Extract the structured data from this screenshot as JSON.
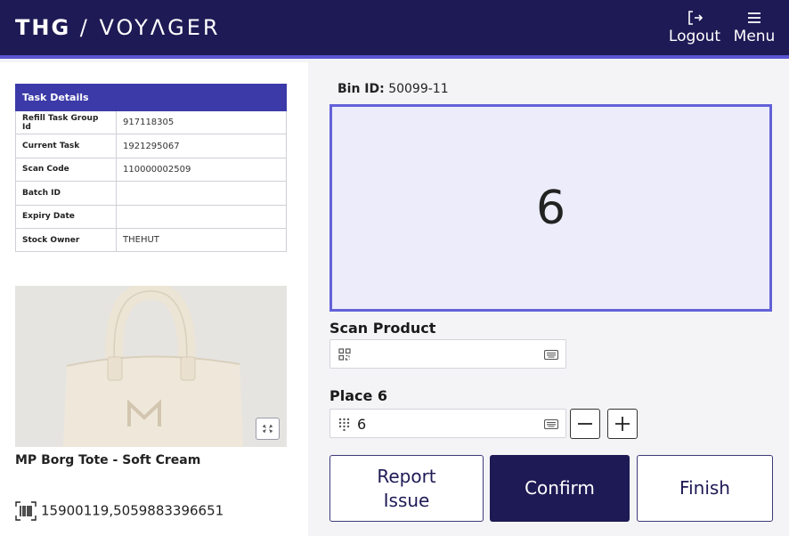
{
  "header": {
    "brand_bold": "THG",
    "brand_sep": " / ",
    "brand_light": "VOYΛGER",
    "logout_label": "Logout",
    "menu_label": "Menu"
  },
  "task_details": {
    "title": "Task Details",
    "rows": [
      {
        "label": "Refill Task Group Id",
        "value": "917118305"
      },
      {
        "label": "Current Task",
        "value": "1921295067"
      },
      {
        "label": "Scan Code",
        "value": "110000002509"
      },
      {
        "label": "Batch ID",
        "value": ""
      },
      {
        "label": "Expiry Date",
        "value": ""
      },
      {
        "label": "Stock Owner",
        "value": "THEHUT"
      }
    ]
  },
  "product": {
    "name": "MP Borg Tote - Soft Cream",
    "barcodes": "15900119,5059883396651"
  },
  "bin": {
    "label": "Bin ID:",
    "value": "50099-11",
    "quantity": "6"
  },
  "scan_product": {
    "label": "Scan Product",
    "value": ""
  },
  "place": {
    "label": "Place 6",
    "value": "6"
  },
  "actions": {
    "report_label": "Report\nIssue",
    "confirm_label": "Confirm",
    "finish_label": "Finish"
  },
  "colors": {
    "header_bg": "#1e1a55",
    "accent": "#5a55d2",
    "table_header": "#3b3aa8",
    "qty_box_bg": "#ececfa"
  }
}
